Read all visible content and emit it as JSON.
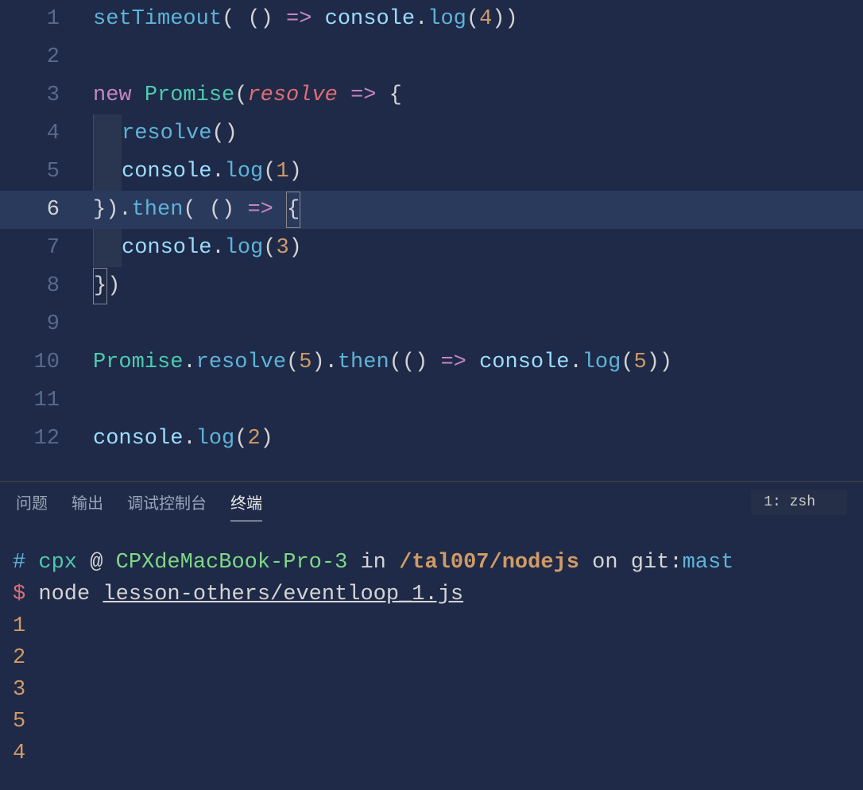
{
  "editor": {
    "lines": [
      {
        "num": 1,
        "tokens": [
          {
            "t": "setTimeout",
            "c": "tok-fn"
          },
          {
            "t": "( () ",
            "c": "tok-punc"
          },
          {
            "t": "=>",
            "c": "tok-arrow"
          },
          {
            "t": " ",
            "c": "tok-punc"
          },
          {
            "t": "console",
            "c": "tok-var"
          },
          {
            "t": ".",
            "c": "tok-dot"
          },
          {
            "t": "log",
            "c": "tok-method"
          },
          {
            "t": "(",
            "c": "tok-punc"
          },
          {
            "t": "4",
            "c": "tok-num"
          },
          {
            "t": "))",
            "c": "tok-punc"
          }
        ]
      },
      {
        "num": 2,
        "tokens": []
      },
      {
        "num": 3,
        "tokens": [
          {
            "t": "new",
            "c": "tok-keyword"
          },
          {
            "t": " ",
            "c": "tok-punc"
          },
          {
            "t": "Promise",
            "c": "tok-class"
          },
          {
            "t": "(",
            "c": "tok-punc"
          },
          {
            "t": "resolve",
            "c": "tok-param"
          },
          {
            "t": " ",
            "c": "tok-punc"
          },
          {
            "t": "=>",
            "c": "tok-arrow"
          },
          {
            "t": " {",
            "c": "tok-punc"
          }
        ]
      },
      {
        "num": 4,
        "indent": true,
        "tokens": [
          {
            "t": "resolve",
            "c": "tok-fn"
          },
          {
            "t": "()",
            "c": "tok-punc"
          }
        ]
      },
      {
        "num": 5,
        "indent": true,
        "tokens": [
          {
            "t": "console",
            "c": "tok-var"
          },
          {
            "t": ".",
            "c": "tok-dot"
          },
          {
            "t": "log",
            "c": "tok-method"
          },
          {
            "t": "(",
            "c": "tok-punc"
          },
          {
            "t": "1",
            "c": "tok-num"
          },
          {
            "t": ")",
            "c": "tok-punc"
          }
        ]
      },
      {
        "num": 6,
        "active": true,
        "highlighted": true,
        "tokens": [
          {
            "t": "}).",
            "c": "tok-punc"
          },
          {
            "t": "then",
            "c": "tok-method"
          },
          {
            "t": "( () ",
            "c": "tok-punc"
          },
          {
            "t": "=>",
            "c": "tok-arrow"
          },
          {
            "t": " ",
            "c": "tok-punc"
          },
          {
            "t": "{",
            "c": "tok-punc",
            "match": true
          }
        ]
      },
      {
        "num": 7,
        "indent": true,
        "tokens": [
          {
            "t": "console",
            "c": "tok-var"
          },
          {
            "t": ".",
            "c": "tok-dot"
          },
          {
            "t": "log",
            "c": "tok-method"
          },
          {
            "t": "(",
            "c": "tok-punc"
          },
          {
            "t": "3",
            "c": "tok-num"
          },
          {
            "t": ")",
            "c": "tok-punc"
          }
        ]
      },
      {
        "num": 8,
        "tokens": [
          {
            "t": "}",
            "c": "tok-punc",
            "match": true
          },
          {
            "t": ")",
            "c": "tok-punc"
          }
        ]
      },
      {
        "num": 9,
        "tokens": []
      },
      {
        "num": 10,
        "tokens": [
          {
            "t": "Promise",
            "c": "tok-class"
          },
          {
            "t": ".",
            "c": "tok-dot"
          },
          {
            "t": "resolve",
            "c": "tok-method"
          },
          {
            "t": "(",
            "c": "tok-punc"
          },
          {
            "t": "5",
            "c": "tok-num"
          },
          {
            "t": ").",
            "c": "tok-punc"
          },
          {
            "t": "then",
            "c": "tok-method"
          },
          {
            "t": "(() ",
            "c": "tok-punc"
          },
          {
            "t": "=>",
            "c": "tok-arrow"
          },
          {
            "t": " ",
            "c": "tok-punc"
          },
          {
            "t": "console",
            "c": "tok-var"
          },
          {
            "t": ".",
            "c": "tok-dot"
          },
          {
            "t": "log",
            "c": "tok-method"
          },
          {
            "t": "(",
            "c": "tok-punc"
          },
          {
            "t": "5",
            "c": "tok-num"
          },
          {
            "t": "))",
            "c": "tok-punc"
          }
        ]
      },
      {
        "num": 11,
        "tokens": []
      },
      {
        "num": 12,
        "tokens": [
          {
            "t": "console",
            "c": "tok-var"
          },
          {
            "t": ".",
            "c": "tok-dot"
          },
          {
            "t": "log",
            "c": "tok-method"
          },
          {
            "t": "(",
            "c": "tok-punc"
          },
          {
            "t": "2",
            "c": "tok-num"
          },
          {
            "t": ")",
            "c": "tok-punc"
          }
        ]
      }
    ]
  },
  "panel": {
    "tabs": {
      "problems": "问题",
      "output": "输出",
      "debug": "调试控制台",
      "terminal": "终端"
    },
    "terminal_selector": "1: zsh"
  },
  "terminal": {
    "hash": "#",
    "user": "cpx",
    "at": "@",
    "host": "CPXdeMacBook-Pro-3",
    "in": "in",
    "path": "/tal007/nodejs",
    "on": "on",
    "git": "git:",
    "branch": "mast",
    "dollar": "$",
    "cmd": "node",
    "file": "lesson-others/eventloop_1.js",
    "output": [
      "1",
      "2",
      "3",
      "5",
      "4"
    ]
  }
}
